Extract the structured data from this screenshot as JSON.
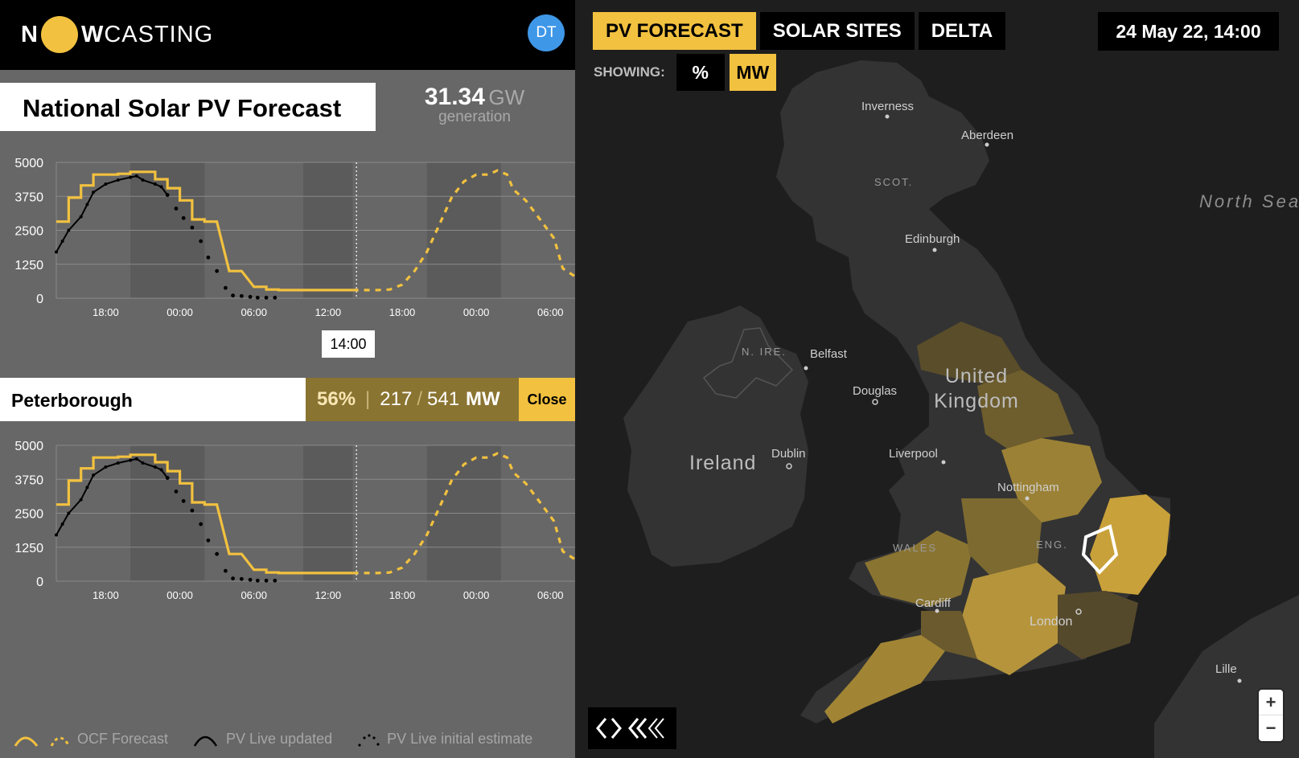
{
  "header": {
    "logo_left": "N",
    "logo_right": "W",
    "logo_rest": "CASTING",
    "avatar_initials": "DT"
  },
  "national": {
    "title": "National Solar PV Forecast",
    "generation_value": "31.34",
    "generation_unit": "GW",
    "generation_label": "generation"
  },
  "selected_time_label": "14:00",
  "region": {
    "name": "Peterborough",
    "percent": "56%",
    "separator": "|",
    "current_mw": "217",
    "slash": "/",
    "capacity_mw": "541",
    "unit": "MW",
    "close_label": "Close"
  },
  "legend": {
    "forecast_label": "OCF Forecast",
    "live_updated_label": "PV Live updated",
    "live_initial_label": "PV Live initial estimate"
  },
  "map": {
    "tabs": [
      {
        "label": "PV FORECAST",
        "active": true
      },
      {
        "label": "SOLAR SITES",
        "active": false
      },
      {
        "label": "DELTA",
        "active": false
      }
    ],
    "date_label": "24 May 22, 14:00",
    "showing_label": "SHOWING:",
    "unit_options": [
      {
        "label": "%",
        "active": false
      },
      {
        "label": "MW",
        "active": true
      }
    ],
    "zoom_in": "+",
    "zoom_out": "−",
    "places": {
      "inverness": "Inverness",
      "aberdeen": "Aberdeen",
      "scot": "SCOT.",
      "edinburgh": "Edinburgh",
      "north_sea": "North Sea",
      "n_ire": "N. IRE.",
      "belfast": "Belfast",
      "douglas": "Douglas",
      "uk": "United Kingdom",
      "ireland": "Ireland",
      "dublin": "Dublin",
      "liverpool": "Liverpool",
      "nottingham": "Nottingham",
      "wales": "WALES",
      "eng": "ENG.",
      "cardiff": "Cardiff",
      "london": "London",
      "lille": "Lille"
    }
  },
  "colors": {
    "accent": "#f2c13f",
    "live": "#000000",
    "panel": "#676767",
    "map_land": "#333333"
  },
  "chart_data": [
    {
      "type": "line",
      "title": "National Solar PV Forecast",
      "ylim": [
        0,
        5000
      ],
      "yticks": [
        0,
        1250,
        2500,
        3750,
        5000
      ],
      "xticks": [
        "18:00",
        "00:00",
        "06:00",
        "12:00",
        "18:00",
        "00:00",
        "06:00"
      ],
      "x_hours": [
        -21,
        -20.5,
        -20,
        -19.5,
        -19,
        -18.5,
        -18,
        -17.5,
        -17,
        -16.5,
        -16,
        -15.5,
        -15,
        -14.5,
        -14,
        -13.5,
        -13,
        -12.5,
        -12,
        -11.5,
        -11,
        -10.5,
        -10,
        -9.5,
        -9,
        -8.5,
        -8,
        -7.5,
        -7,
        -6.5,
        -6,
        -5.5,
        -5,
        -4.5,
        -4,
        -3.5,
        -3,
        -2.5,
        -2,
        -1.5,
        -1,
        -0.5,
        0,
        0.5,
        1,
        1.5,
        2,
        2.5,
        3,
        3.5,
        4,
        4.5,
        5,
        5.5,
        6,
        6.5,
        7,
        7.5,
        8,
        8.5,
        9,
        9.5,
        10,
        10.5,
        11,
        11.5,
        12,
        12.5,
        13,
        13.5,
        14,
        14.5,
        15,
        15.5,
        16,
        16.5,
        17,
        17.5,
        18,
        18.5,
        19,
        19.5,
        20,
        20.5,
        21,
        21.5,
        22,
        22.5,
        23,
        23.5,
        24,
        24.5,
        25,
        25.5,
        26,
        26.5,
        27,
        27.5,
        28,
        28.5,
        29,
        29.5,
        30,
        30.5,
        31,
        31.5,
        32,
        32.5,
        33,
        33.5,
        34,
        34.5,
        35,
        35.5,
        36,
        36.5,
        37,
        37.5,
        38,
        38.5,
        39,
        39.5,
        40,
        40.5,
        41,
        41.5,
        42,
        42.5,
        43,
        43.5,
        44,
        44.5,
        45,
        45.5,
        46,
        46.5,
        47,
        47.5,
        48,
        48.5,
        49,
        49.5,
        50,
        50.5,
        51,
        51.5,
        52,
        52.5,
        53,
        53.5,
        54,
        54.5,
        55,
        55.5,
        56,
        56.5,
        57,
        57.5,
        58,
        58.5,
        59,
        59.5,
        60,
        60.5,
        61,
        61.5,
        62,
        62.5,
        63,
        63.5,
        64,
        64.5,
        65,
        65.5,
        66,
        66.5,
        67,
        67.5,
        68,
        68.5,
        69,
        69.5,
        70,
        70.5,
        71,
        71.5,
        72,
        72.5,
        73,
        73.5,
        74,
        74.5,
        75,
        75.5,
        76,
        76.5,
        77,
        77.5,
        78,
        78.5,
        79,
        79.5,
        80,
        80.5,
        81,
        81.5,
        82,
        82.5,
        83,
        83.5,
        84,
        84.5,
        85,
        85.5,
        86,
        86.5,
        87,
        87.5,
        88,
        88.5,
        89,
        89.5,
        90,
        90.5,
        91,
        91.5,
        92,
        92.5,
        93,
        93.5,
        94,
        94.5,
        95,
        95.5,
        96,
        96.5,
        97,
        97.5,
        98,
        98.5,
        99,
        99.5,
        100
      ],
      "series": [
        {
          "name": "OCF Forecast",
          "style": "solid",
          "points": [
            [
              14,
              2820
            ],
            [
              15,
              2820
            ],
            [
              15,
              3700
            ],
            [
              16,
              3700
            ],
            [
              16,
              4150
            ],
            [
              17,
              4150
            ],
            [
              17,
              4550
            ],
            [
              19,
              4550
            ],
            [
              19,
              4580
            ],
            [
              20,
              4580
            ],
            [
              20,
              4650
            ],
            [
              22,
              4650
            ],
            [
              22,
              4380
            ],
            [
              23,
              4380
            ],
            [
              23,
              4050
            ],
            [
              24,
              4050
            ],
            [
              24,
              3600
            ],
            [
              25,
              3600
            ],
            [
              25,
              2900
            ],
            [
              26,
              2900
            ],
            [
              26,
              2820
            ],
            [
              27,
              2820
            ],
            [
              28,
              1000
            ],
            [
              29,
              1000
            ],
            [
              30,
              420
            ],
            [
              31,
              420
            ],
            [
              31,
              320
            ],
            [
              32,
              320
            ],
            [
              32,
              300
            ],
            [
              38,
              300
            ]
          ]
        },
        {
          "name": "OCF Forecast (future)",
          "style": "dashed",
          "points": [
            [
              38,
              300
            ],
            [
              40,
              300
            ],
            [
              41,
              320
            ],
            [
              42,
              500
            ],
            [
              43,
              1000
            ],
            [
              44,
              1700
            ],
            [
              45,
              2700
            ],
            [
              46,
              3700
            ],
            [
              47,
              4300
            ],
            [
              48,
              4550
            ],
            [
              49,
              4550
            ],
            [
              49.7,
              4700
            ],
            [
              50.5,
              4550
            ],
            [
              51,
              4000
            ],
            [
              52,
              3600
            ],
            [
              53,
              3000
            ],
            [
              54.3,
              2200
            ],
            [
              55,
              1100
            ],
            [
              56,
              800
            ]
          ]
        },
        {
          "name": "PV Live updated",
          "style": "solid",
          "points": [
            [
              14,
              1700
            ],
            [
              14.5,
              2100
            ],
            [
              15,
              2500
            ],
            [
              16,
              3000
            ],
            [
              16.5,
              3450
            ],
            [
              17,
              3900
            ],
            [
              18,
              4200
            ],
            [
              19,
              4350
            ],
            [
              20,
              4450
            ],
            [
              20.5,
              4500
            ],
            [
              21,
              4350
            ],
            [
              22,
              4200
            ],
            [
              22.5,
              4100
            ],
            [
              23,
              3800
            ]
          ]
        },
        {
          "name": "PV Live initial estimate",
          "style": "dots",
          "points": [
            [
              23,
              3800
            ],
            [
              23.7,
              3300
            ],
            [
              24.3,
              2950
            ],
            [
              25,
              2600
            ],
            [
              25.7,
              2100
            ],
            [
              26.3,
              1500
            ],
            [
              27,
              1000
            ],
            [
              27.7,
              380
            ],
            [
              28.3,
              100
            ],
            [
              29,
              80
            ],
            [
              29.7,
              50
            ],
            [
              30.3,
              20
            ],
            [
              31,
              20
            ],
            [
              31.7,
              20
            ]
          ]
        }
      ],
      "hour_window": {
        "start": 14,
        "end": 56,
        "now": 38.3
      },
      "night_bands": [
        [
          20,
          26
        ],
        [
          34,
          38
        ],
        [
          44,
          50
        ],
        [
          56,
          62
        ]
      ]
    },
    {
      "type": "line",
      "title": "Peterborough",
      "ylim": [
        0,
        5000
      ],
      "yticks": [
        0,
        1250,
        2500,
        3750,
        5000
      ],
      "xticks": [
        "18:00",
        "00:00",
        "06:00",
        "12:00",
        "18:00",
        "00:00",
        "06:00"
      ],
      "series": [
        {
          "name": "OCF Forecast",
          "style": "solid",
          "points": [
            [
              14,
              2820
            ],
            [
              15,
              2820
            ],
            [
              15,
              3700
            ],
            [
              16,
              3700
            ],
            [
              16,
              4150
            ],
            [
              17,
              4150
            ],
            [
              17,
              4550
            ],
            [
              19,
              4550
            ],
            [
              19,
              4580
            ],
            [
              20,
              4580
            ],
            [
              20,
              4650
            ],
            [
              22,
              4650
            ],
            [
              22,
              4380
            ],
            [
              23,
              4380
            ],
            [
              23,
              4050
            ],
            [
              24,
              4050
            ],
            [
              24,
              3600
            ],
            [
              25,
              3600
            ],
            [
              25,
              2900
            ],
            [
              26,
              2900
            ],
            [
              26,
              2820
            ],
            [
              27,
              2820
            ],
            [
              28,
              1000
            ],
            [
              29,
              1000
            ],
            [
              30,
              420
            ],
            [
              31,
              420
            ],
            [
              31,
              320
            ],
            [
              32,
              320
            ],
            [
              32,
              300
            ],
            [
              38,
              300
            ]
          ]
        },
        {
          "name": "OCF Forecast (future)",
          "style": "dashed",
          "points": [
            [
              38,
              300
            ],
            [
              40,
              300
            ],
            [
              41,
              320
            ],
            [
              42,
              500
            ],
            [
              43,
              1000
            ],
            [
              44,
              1700
            ],
            [
              45,
              2700
            ],
            [
              46,
              3700
            ],
            [
              47,
              4300
            ],
            [
              48,
              4550
            ],
            [
              49,
              4550
            ],
            [
              49.7,
              4700
            ],
            [
              50.5,
              4550
            ],
            [
              51,
              4000
            ],
            [
              52,
              3600
            ],
            [
              53,
              3000
            ],
            [
              54.3,
              2200
            ],
            [
              55,
              1100
            ],
            [
              56,
              800
            ]
          ]
        },
        {
          "name": "PV Live updated",
          "style": "solid",
          "points": [
            [
              14,
              1700
            ],
            [
              14.5,
              2100
            ],
            [
              15,
              2500
            ],
            [
              16,
              3000
            ],
            [
              16.5,
              3450
            ],
            [
              17,
              3900
            ],
            [
              18,
              4200
            ],
            [
              19,
              4350
            ],
            [
              20,
              4450
            ],
            [
              20.5,
              4500
            ],
            [
              21,
              4350
            ],
            [
              22,
              4200
            ],
            [
              22.5,
              4100
            ],
            [
              23,
              3800
            ]
          ]
        },
        {
          "name": "PV Live initial estimate",
          "style": "dots",
          "points": [
            [
              23,
              3800
            ],
            [
              23.7,
              3300
            ],
            [
              24.3,
              2950
            ],
            [
              25,
              2600
            ],
            [
              25.7,
              2100
            ],
            [
              26.3,
              1500
            ],
            [
              27,
              1000
            ],
            [
              27.7,
              380
            ],
            [
              28.3,
              100
            ],
            [
              29,
              80
            ],
            [
              29.7,
              50
            ],
            [
              30.3,
              20
            ],
            [
              31,
              20
            ],
            [
              31.7,
              20
            ]
          ]
        }
      ],
      "hour_window": {
        "start": 14,
        "end": 56,
        "now": 38.3
      },
      "night_bands": [
        [
          20,
          26
        ],
        [
          34,
          38
        ],
        [
          44,
          50
        ],
        [
          56,
          62
        ]
      ]
    }
  ]
}
